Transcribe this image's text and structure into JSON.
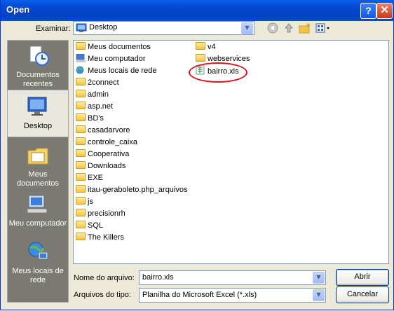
{
  "window": {
    "title": "Open",
    "help_label": "?",
    "close_label": "✕"
  },
  "lookin": {
    "label": "Examinar:",
    "value": "Desktop"
  },
  "places": [
    {
      "label": "Documentos recentes",
      "icon": "recent-docs-icon"
    },
    {
      "label": "Desktop",
      "icon": "desktop-icon"
    },
    {
      "label": "Meus documentos",
      "icon": "my-documents-icon"
    },
    {
      "label": "Meu computador",
      "icon": "my-computer-icon"
    },
    {
      "label": "Meus locais de rede",
      "icon": "network-places-icon"
    }
  ],
  "files_col1": [
    "Meus documentos",
    "Meu computador",
    "Meus locais de rede",
    "2connect",
    "admin",
    "asp.net",
    "BD's",
    "casadarvore",
    "controle_caixa",
    "Cooperativa",
    "Downloads",
    "EXE",
    "itau-geraboleto.php_arquivos",
    "js",
    "precisionrh",
    "SQL",
    "The Killers"
  ],
  "files_col2": [
    "v4",
    "webservices",
    "bairro.xls"
  ],
  "filename": {
    "label": "Nome do arquivo:",
    "value": "bairro.xls"
  },
  "filetype": {
    "label": "Arquivos do tipo:",
    "value": "Planilha do Microsoft Excel (*.xls)"
  },
  "buttons": {
    "open": "Abrir",
    "cancel": "Cancelar"
  },
  "colors": {
    "titlebar": "#0A5FE8",
    "highlight_circle": "#D8141C",
    "places_bg": "#7B7A72"
  }
}
